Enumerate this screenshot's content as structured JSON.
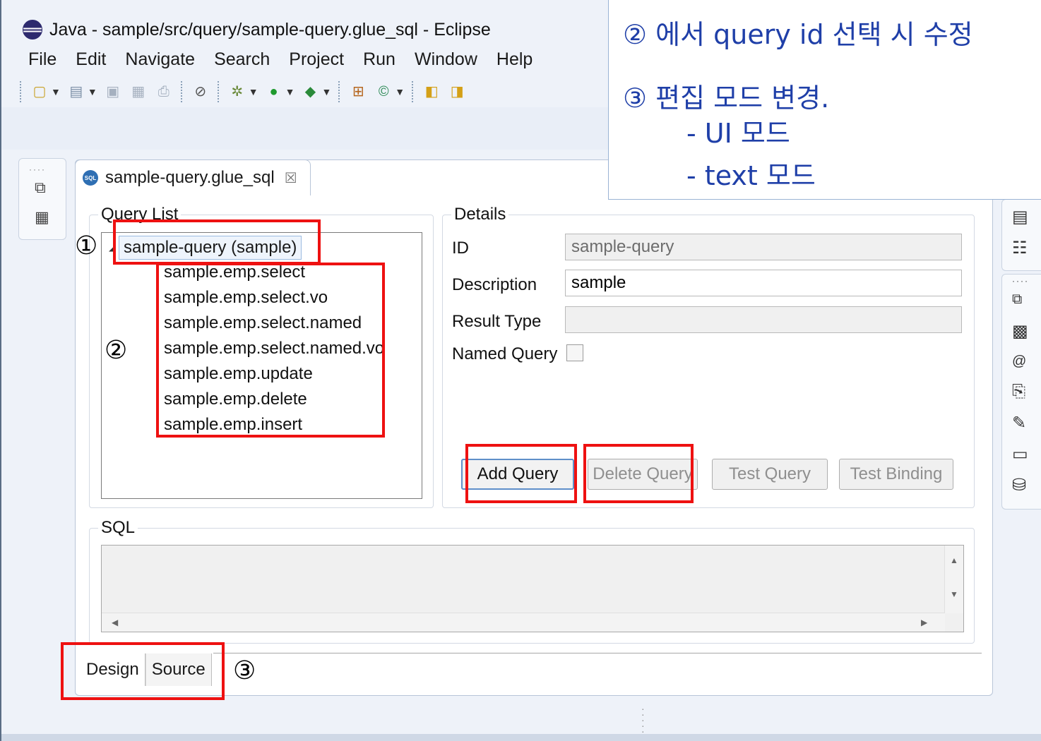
{
  "window": {
    "title": "Java - sample/src/query/sample-query.glue_sql - Eclipse",
    "app_icon": "eclipse-icon"
  },
  "menu": [
    "File",
    "Edit",
    "Navigate",
    "Search",
    "Project",
    "Run",
    "Window",
    "Help"
  ],
  "callout": {
    "line1": "② 에서 query id 선택 시  수정",
    "line2": "③ 편집 모드 변경.",
    "line3": "- UI 모드",
    "line4": "- text 모드"
  },
  "editor": {
    "tab_title": "sample-query.glue_sql",
    "tab_icon_text": "SQL",
    "query_list": {
      "legend": "Query List",
      "root": "sample-query (sample)",
      "items": [
        "sample.emp.select",
        "sample.emp.select.vo",
        "sample.emp.select.named",
        "sample.emp.select.named.vo",
        "sample.emp.update",
        "sample.emp.delete",
        "sample.emp.insert"
      ]
    },
    "details": {
      "legend": "Details",
      "id_label": "ID",
      "id_value": "sample-query",
      "description_label": "Description",
      "description_value": "sample",
      "result_type_label": "Result Type",
      "result_type_value": "",
      "named_query_label": "Named Query",
      "named_query_checked": false,
      "buttons": {
        "add": "Add Query",
        "delete": "Delete Query",
        "test": "Test Query",
        "binding": "Test Binding"
      }
    },
    "sql": {
      "legend": "SQL",
      "value": ""
    },
    "bottom_tabs": [
      "Design",
      "Source"
    ]
  },
  "annotations": {
    "marker1": "①",
    "marker2": "②",
    "marker3": "③",
    "box_color": "#ee1111"
  },
  "colors": {
    "callout_text": "#1f3fa8",
    "selection_border": "#9bbbe0"
  }
}
